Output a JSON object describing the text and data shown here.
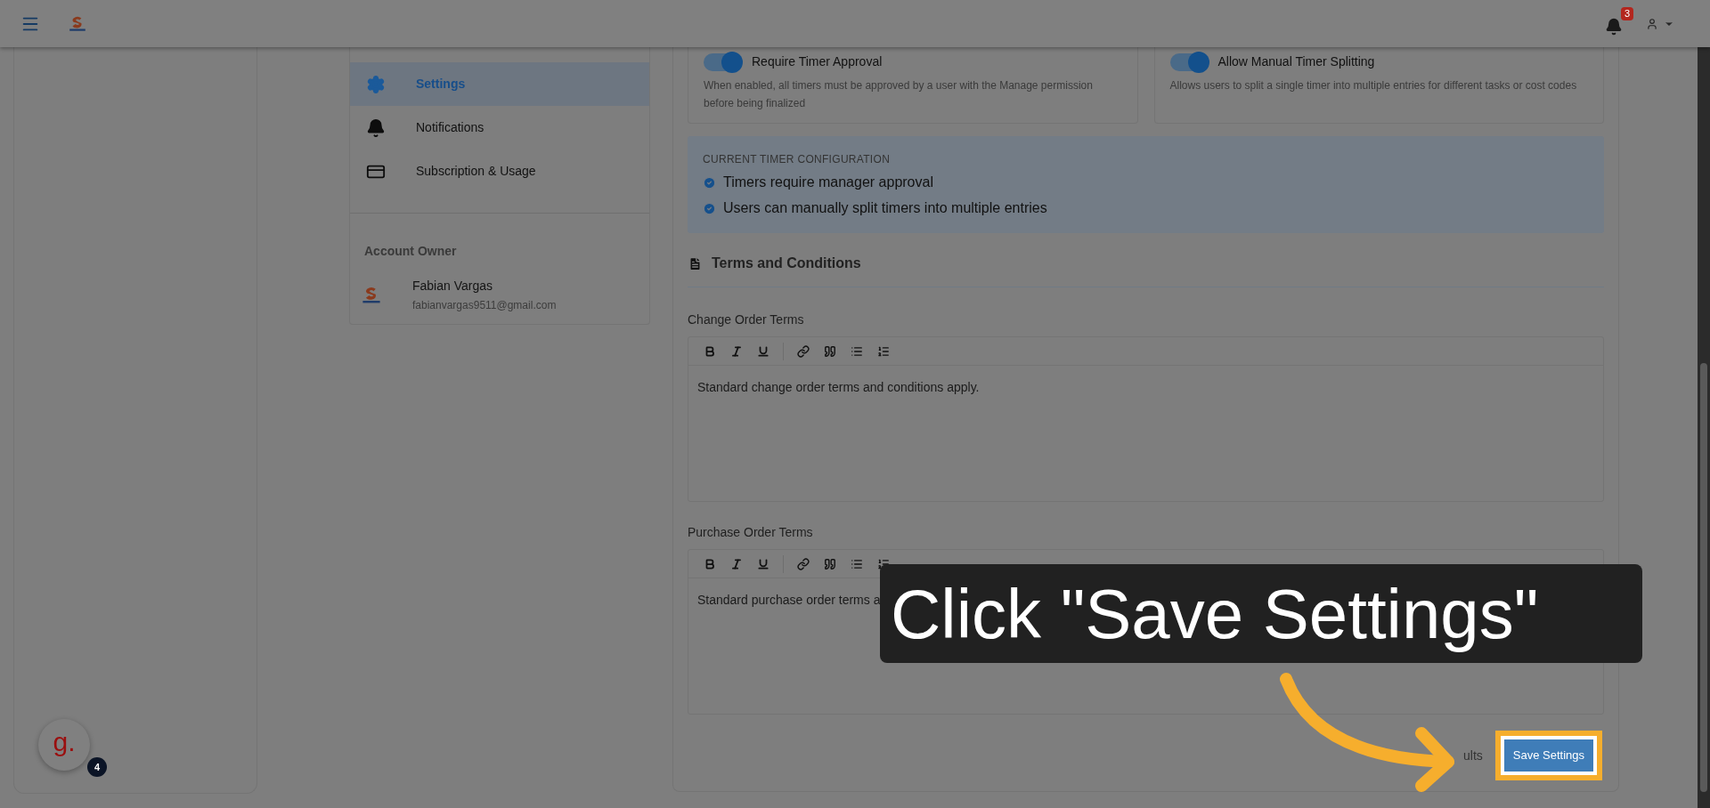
{
  "top_bar": {
    "notification_count": "3"
  },
  "help_widget": {
    "letter": "g.",
    "count": "4"
  },
  "settings_nav": {
    "items": [
      {
        "label": "Settings",
        "selected": true
      },
      {
        "label": "Notifications",
        "selected": false
      },
      {
        "label": "Subscription & Usage",
        "selected": false
      }
    ],
    "account_owner": {
      "heading": "Account Owner",
      "name": "Fabian Vargas",
      "email": "fabianvargas9511@gmail.com"
    }
  },
  "timer_toggles": [
    {
      "label": "Require Timer Approval",
      "on": true,
      "description": "When enabled, all timers must be approved by a user with the Manage permission before being finalized"
    },
    {
      "label": "Allow Manual Timer Splitting",
      "on": true,
      "description": "Allows users to split a single timer into multiple entries for different tasks or cost codes"
    }
  ],
  "timer_configuration": {
    "title": "CURRENT TIMER CONFIGURATION",
    "items": [
      "Timers require manager approval",
      "Users can manually split timers into multiple entries"
    ]
  },
  "terms_section": {
    "title": "Terms and Conditions",
    "editors": [
      {
        "label": "Change Order Terms",
        "content": "Standard change order terms and conditions apply."
      },
      {
        "label": "Purchase Order Terms",
        "content": "Standard purchase order terms a"
      }
    ]
  },
  "footer": {
    "partial_button": "ults",
    "save_button": "Save Settings"
  },
  "callout": {
    "text": "Click \"Save Settings\""
  }
}
